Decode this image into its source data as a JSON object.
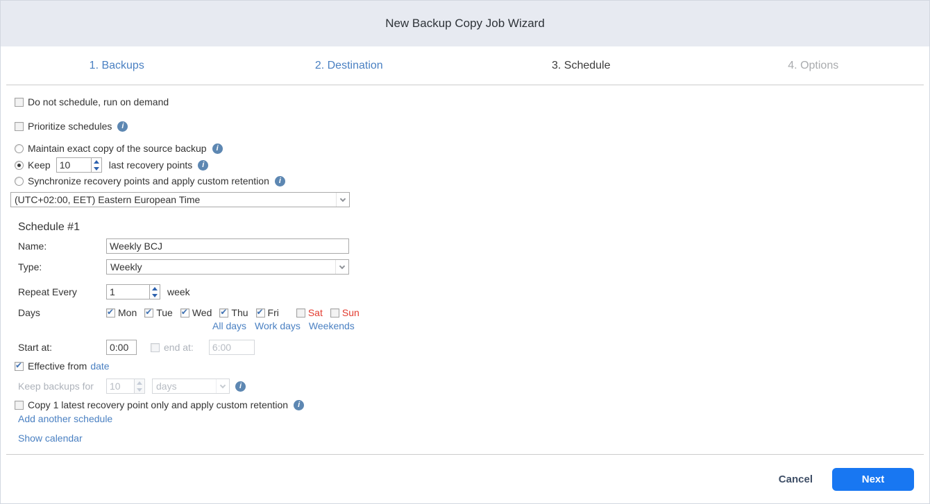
{
  "header": {
    "title": "New Backup Copy Job Wizard"
  },
  "tabs": [
    {
      "label": "1. Backups",
      "state": "link"
    },
    {
      "label": "2. Destination",
      "state": "link"
    },
    {
      "label": "3. Schedule",
      "state": "active"
    },
    {
      "label": "4. Options",
      "state": "disabled"
    }
  ],
  "options": {
    "run_on_demand": {
      "label": "Do not schedule, run on demand",
      "checked": false
    },
    "prioritize": {
      "label": "Prioritize schedules",
      "checked": false
    },
    "retention": [
      {
        "label": "Maintain exact copy of the source backup",
        "selected": false
      },
      {
        "label_prefix": "Keep",
        "value": "10",
        "label_suffix": "last recovery points",
        "selected": true
      },
      {
        "label": "Synchronize recovery points and apply custom retention",
        "selected": false
      }
    ],
    "timezone": "(UTC+02:00, EET) Eastern European Time"
  },
  "schedule": {
    "heading": "Schedule #1",
    "name_label": "Name:",
    "name_value": "Weekly BCJ",
    "type_label": "Type:",
    "type_value": "Weekly",
    "repeat_label": "Repeat Every",
    "repeat_value": "1",
    "repeat_unit": "week",
    "days_label": "Days",
    "days": [
      {
        "label": "Mon",
        "checked": true
      },
      {
        "label": "Tue",
        "checked": true
      },
      {
        "label": "Wed",
        "checked": true
      },
      {
        "label": "Thu",
        "checked": true
      },
      {
        "label": "Fri",
        "checked": true
      },
      {
        "label": "Sat",
        "checked": false,
        "weekend": true
      },
      {
        "label": "Sun",
        "checked": false,
        "weekend": true
      }
    ],
    "day_links": [
      "All days",
      "Work days",
      "Weekends"
    ],
    "start_label": "Start at:",
    "start_value": "0:00",
    "end_checked": false,
    "end_label": "end at:",
    "end_value": "6:00",
    "effective_checked": true,
    "effective_label": "Effective from",
    "effective_link": "date",
    "keep_label": "Keep backups for",
    "keep_value": "10",
    "keep_unit": "days",
    "copy_latest": {
      "label": "Copy 1 latest recovery point only and apply custom retention",
      "checked": false
    },
    "add_link": "Add another schedule",
    "calendar_link": "Show calendar"
  },
  "footer": {
    "cancel": "Cancel",
    "next": "Next"
  },
  "colors": {
    "header_bg": "#e7eaf1",
    "tab_link": "#4a80c2",
    "link": "#4a80c2",
    "weekend_red": "#e23a2e",
    "info_icon": "#5d87b2",
    "next_button": "#1877f2",
    "cancel_text": "#3e4e66"
  }
}
